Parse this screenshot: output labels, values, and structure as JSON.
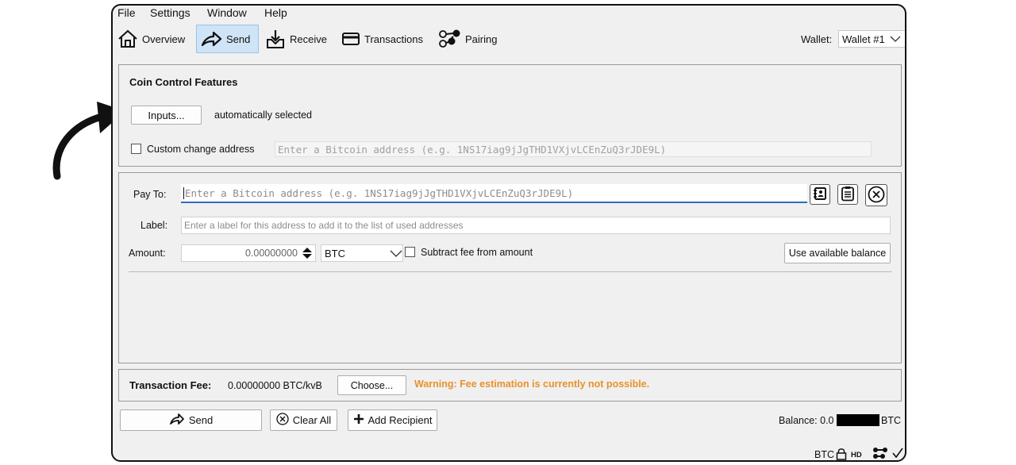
{
  "menu": [
    "File",
    "Settings",
    "Window",
    "Help"
  ],
  "toolbar": {
    "overview": "Overview",
    "send": "Send",
    "receive": "Receive",
    "transactions": "Transactions",
    "pairing": "Pairing",
    "wallet_label": "Wallet:",
    "wallet_value": "Wallet #1"
  },
  "coin_control": {
    "title": "Coin Control Features",
    "inputs_button": "Inputs...",
    "inputs_status": "automatically selected",
    "custom_change_label": "Custom change address",
    "custom_change_checked": false,
    "custom_change_placeholder": "Enter a Bitcoin address (e.g. 1NS17iag9jJgTHD1VXjvLCEnZuQ3rJDE9L)"
  },
  "recipient": {
    "pay_to_label": "Pay To:",
    "pay_to_placeholder": "Enter a Bitcoin address (e.g. 1NS17iag9jJgTHD1VXjvLCEnZuQ3rJDE9L)",
    "label_label": "Label:",
    "label_placeholder": "Enter a label for this address to add it to the list of used addresses",
    "amount_label": "Amount:",
    "amount_value": "0.00000000",
    "unit": "BTC",
    "subtract_fee_label": "Subtract fee from amount",
    "subtract_fee_checked": false,
    "use_balance_button": "Use available balance"
  },
  "fee": {
    "label": "Transaction Fee:",
    "value": "0.00000000 BTC/kvB",
    "choose_button": "Choose...",
    "warning": "Warning: Fee estimation is currently not possible.",
    "warning_color": "#e8912b"
  },
  "actions": {
    "send": "Send",
    "clear_all": "Clear All",
    "add_recipient": "Add Recipient"
  },
  "balance": {
    "label": "Balance: 0.0",
    "unit": "BTC"
  },
  "statusbar": {
    "unit": "BTC",
    "hd": "HD"
  }
}
